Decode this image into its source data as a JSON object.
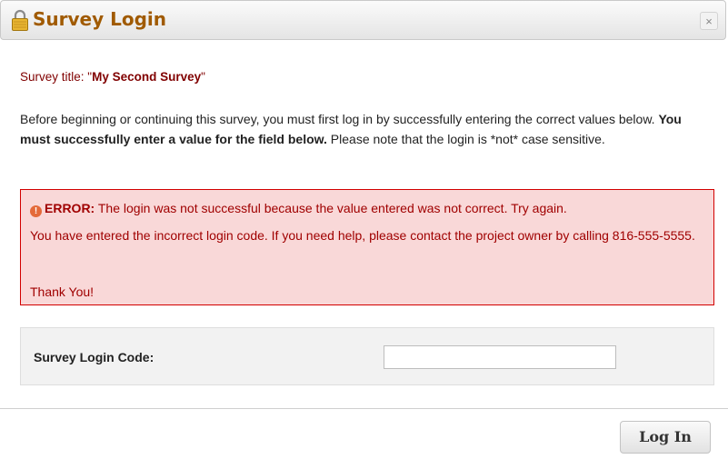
{
  "dialog": {
    "title": "Survey Login",
    "close_label": "×"
  },
  "survey_title": {
    "prefix": "Survey title: \"",
    "name": "My Second Survey",
    "suffix": "\""
  },
  "intro": {
    "part1": "Before beginning or continuing this survey, you must first log in by successfully entering the correct values below. ",
    "bold": "You must successfully enter a value for the field below.",
    "part2": " Please note that the login is *not* case sensitive."
  },
  "error": {
    "icon_glyph": "!",
    "label": "ERROR:",
    "message": " The login was not successful because the value entered was not correct. Try again.",
    "detail": "You have entered the incorrect login code. If you need help, please contact the project owner by calling 816-555-5555.",
    "thanks": "Thank You!"
  },
  "login": {
    "label": "Survey Login Code:",
    "value": "",
    "placeholder": ""
  },
  "button": {
    "label": "Log In"
  },
  "colors": {
    "title": "#a05a00",
    "error_bg": "#f9d8d8",
    "error_border": "#d20000",
    "error_text": "#a00000",
    "survey_title": "#800000"
  },
  "icons": {
    "title_icon": "lock-icon",
    "error_icon": "error-circle-icon",
    "close_icon": "close-icon"
  }
}
